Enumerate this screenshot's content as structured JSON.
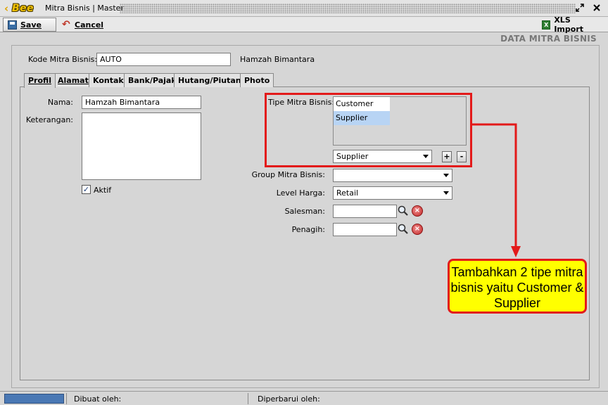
{
  "window": {
    "logo_text": "Bee",
    "title": "Mitra Bisnis | Master",
    "restore_icon": "restore-icon",
    "close_icon": "close-icon"
  },
  "toolbar": {
    "save_label": "Save",
    "cancel_label": "Cancel",
    "xls_import_label": "XLS Import"
  },
  "section_title": "DATA MITRA BISNIS",
  "header": {
    "kode_label": "Kode Mitra Bisnis:",
    "kode_value": "AUTO",
    "display_name": "Hamzah Bimantara"
  },
  "tabs": [
    {
      "label": "Profil",
      "active": true
    },
    {
      "label": "Alamat",
      "active": false
    },
    {
      "label": "Kontak",
      "active": false
    },
    {
      "label": "Bank/Pajak",
      "active": false
    },
    {
      "label": "Hutang/Piutang",
      "active": false
    },
    {
      "label": "Photo",
      "active": false
    }
  ],
  "profil": {
    "nama_label": "Nama:",
    "nama_value": "Hamzah Bimantara",
    "keterangan_label": "Keterangan:",
    "keterangan_value": "",
    "aktif_label": "Aktif",
    "aktif_checked": true,
    "tipe_label": "Tipe Mitra Bisnis:",
    "tipe_items": [
      "Customer",
      "Supplier"
    ],
    "tipe_selected_index": 1,
    "tipe_dropdown_value": "Supplier",
    "add_label": "+",
    "remove_label": "-",
    "group_label": "Group Mitra Bisnis:",
    "group_value": "",
    "level_label": "Level Harga:",
    "level_value": "Retail",
    "salesman_label": "Salesman:",
    "salesman_value": "",
    "penagih_label": "Penagih:",
    "penagih_value": ""
  },
  "annotation": {
    "callout_text": "Tambahkan 2 tipe mitra bisnis yaitu Customer & Supplier",
    "box_color": "#e31a1a",
    "callout_bg": "#ffff00"
  },
  "status": {
    "dibuat_label": "Dibuat oleh:",
    "diperbarui_label": "Diperbarui oleh:"
  },
  "colors": {
    "selection": "#b8d4f4",
    "status_progress": "#4a78b4"
  }
}
